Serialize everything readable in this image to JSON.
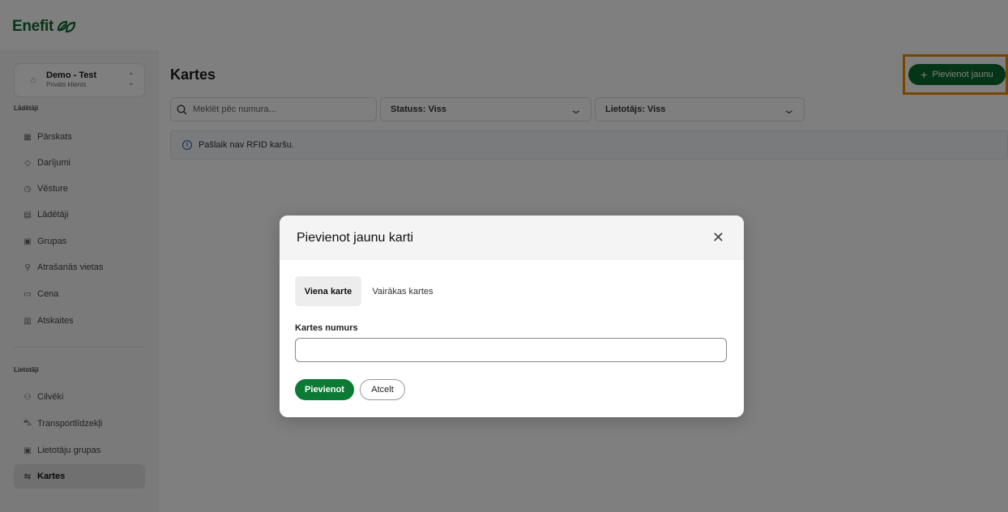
{
  "brand": {
    "name": "Enefit",
    "logo_icon": "enefit-leaf-logo",
    "color": "#0b6b2e"
  },
  "account": {
    "name": "Demo - Test",
    "type": "Privāts klients"
  },
  "sidebar": {
    "section1_title": "Lādētāji",
    "items1": [
      {
        "label": "Pārskats",
        "icon": "grid-icon"
      },
      {
        "label": "Darījumi",
        "icon": "tag-icon"
      },
      {
        "label": "Vēsture",
        "icon": "clock-icon"
      },
      {
        "label": "Lādētāji",
        "icon": "charger-icon"
      },
      {
        "label": "Grupas",
        "icon": "group-icon"
      },
      {
        "label": "Atrašanās vietas",
        "icon": "location-icon"
      },
      {
        "label": "Cena",
        "icon": "price-icon"
      },
      {
        "label": "Atskaites",
        "icon": "report-icon"
      }
    ],
    "section2_title": "Lietotāji",
    "items2": [
      {
        "label": "Cilvēki",
        "icon": "people-icon"
      },
      {
        "label": "Transportlīdzekļi",
        "icon": "car-icon"
      },
      {
        "label": "Lietotāju grupas",
        "icon": "user-group-icon"
      },
      {
        "label": "Kartes",
        "icon": "card-icon",
        "active": true
      }
    ]
  },
  "main": {
    "title": "Kartes",
    "add_button": "Pievienot jaunu",
    "search_placeholder": "Meklēt pēc numura...",
    "filter_status": "Statuss: Viss",
    "filter_user": "Lietotājs: Viss",
    "info_message": "Pašlaik nav RFID karšu."
  },
  "modal": {
    "title": "Pievienot jaunu karti",
    "tab_single": "Viena karte",
    "tab_multiple": "Vairākas kartes",
    "field_label": "Kartes numurs",
    "field_value": "",
    "submit": "Pievienot",
    "cancel": "Atcelt"
  },
  "colors": {
    "primary": "#0b6b2e",
    "highlight": "#f08a00",
    "info_border": "#dfe6ef"
  }
}
